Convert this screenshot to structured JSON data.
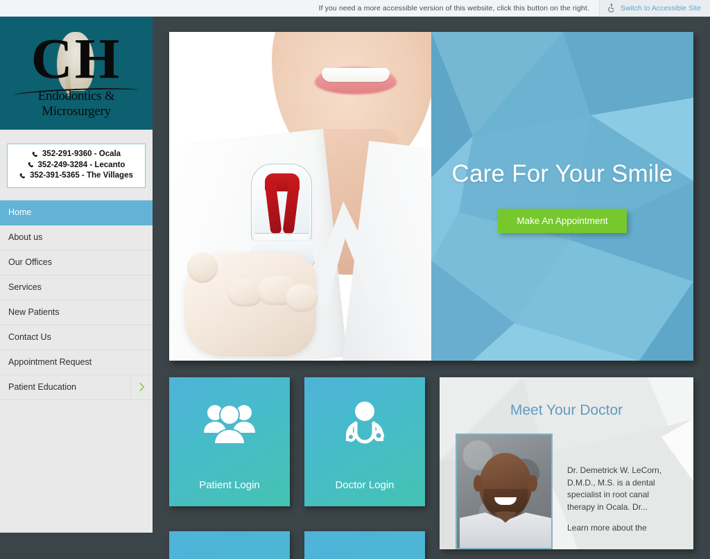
{
  "accessibility_bar": {
    "message": "If you need a more accessible version of this website, click this button on the right.",
    "button_label": "Switch to Accessible Site",
    "icon": "wheelchair-accessibility-icon",
    "link_color": "#5aa8d6"
  },
  "sidebar": {
    "logo": {
      "initials": "CH",
      "subtitle": "Endodontics & Microsurgery",
      "background_color": "#0c6070"
    },
    "phones": [
      {
        "icon": "phone-icon",
        "number": "352-291-9360",
        "location": "Ocala",
        "text": "352-291-9360 - Ocala"
      },
      {
        "icon": "phone-icon",
        "number": "352-249-3284",
        "location": "Lecanto",
        "text": "352-249-3284 - Lecanto"
      },
      {
        "icon": "phone-icon",
        "number": "352-391-5365",
        "location": "The Villages",
        "text": "352-391-5365 - The Villages"
      }
    ],
    "nav_items": [
      {
        "label": "Home",
        "active": true,
        "has_submenu": false
      },
      {
        "label": "About us",
        "active": false,
        "has_submenu": false
      },
      {
        "label": "Our Offices",
        "active": false,
        "has_submenu": false
      },
      {
        "label": "Services",
        "active": false,
        "has_submenu": false
      },
      {
        "label": "New Patients",
        "active": false,
        "has_submenu": false
      },
      {
        "label": "Contact Us",
        "active": false,
        "has_submenu": false
      },
      {
        "label": "Appointment Request",
        "active": false,
        "has_submenu": false
      },
      {
        "label": "Patient Education",
        "active": false,
        "has_submenu": true
      }
    ],
    "active_nav_color": "#63b3d6",
    "submenu_chevron_color": "#8cc63f"
  },
  "hero": {
    "title": "Care For Your Smile",
    "cta_label": "Make An Appointment",
    "cta_color": "#76c82d",
    "panel_color": "#6cb2d1",
    "image_alt": "dental-professional-holding-tooth-model"
  },
  "tiles": [
    {
      "label": "Patient Login",
      "icon": "group-of-people-icon"
    },
    {
      "label": "Doctor Login",
      "icon": "doctor-stethoscope-icon"
    }
  ],
  "doctor_panel": {
    "title": "Meet Your Doctor",
    "title_color": "#5e9dc2",
    "photo_alt": "doctor-portrait",
    "bio": "Dr. Demetrick W. LeCorn, D.M.D., M.S. is a dental specialist in root canal therapy in Ocala. Dr...",
    "secondary_line": "Learn more about the"
  }
}
